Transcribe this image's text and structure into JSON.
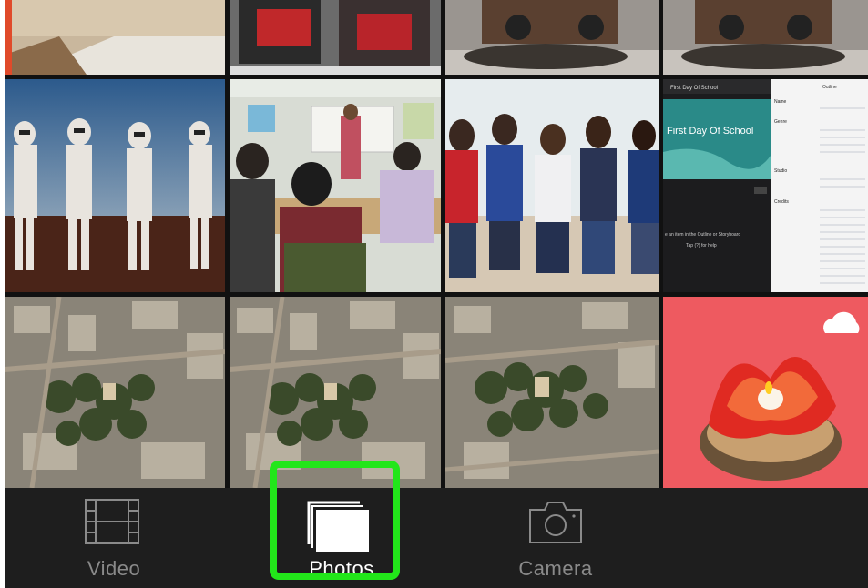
{
  "tabs": [
    {
      "id": "video",
      "label": "Video",
      "icon": "film-strip-icon",
      "active": false
    },
    {
      "id": "photos",
      "label": "Photos",
      "icon": "stacked-photos-icon",
      "active": true
    },
    {
      "id": "camera",
      "label": "Camera",
      "icon": "camera-icon",
      "active": false
    }
  ],
  "thumbnail_screenshot": {
    "header": "First Day Of School",
    "slide_title": "First Day Of School",
    "hint": "e an item in the Outline or Storyboard",
    "help": "Tap (?) for help",
    "panel_tab1": "Outline",
    "panel_sections": [
      "Name",
      "Genre",
      "Studio",
      "Credits"
    ]
  },
  "colors": {
    "tabbar_bg": "#1e1e1e",
    "active_label": "#ffffff",
    "inactive_label": "#8a8a8a",
    "highlight": "#22e61a"
  }
}
